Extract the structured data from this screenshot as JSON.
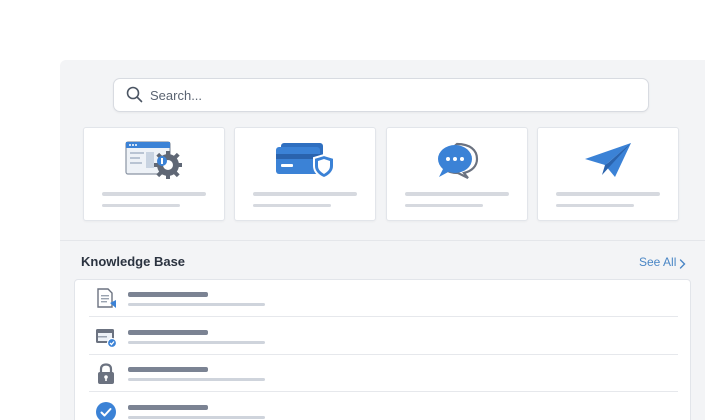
{
  "search": {
    "placeholder": "Search..."
  },
  "cards": [
    {
      "icon": "browser-settings-icon"
    },
    {
      "icon": "credit-card-shield-icon"
    },
    {
      "icon": "chat-bubbles-icon"
    },
    {
      "icon": "paper-plane-icon"
    }
  ],
  "knowledge_base": {
    "title": "Knowledge Base",
    "see_all": "See All",
    "items": [
      {
        "icon": "document-video-icon"
      },
      {
        "icon": "window-check-icon"
      },
      {
        "icon": "lock-icon"
      },
      {
        "icon": "checkmark-circle-icon"
      }
    ]
  },
  "colors": {
    "accent": "#4a86c5",
    "icon_blue": "#3b82d6",
    "icon_gray": "#6b7280"
  }
}
